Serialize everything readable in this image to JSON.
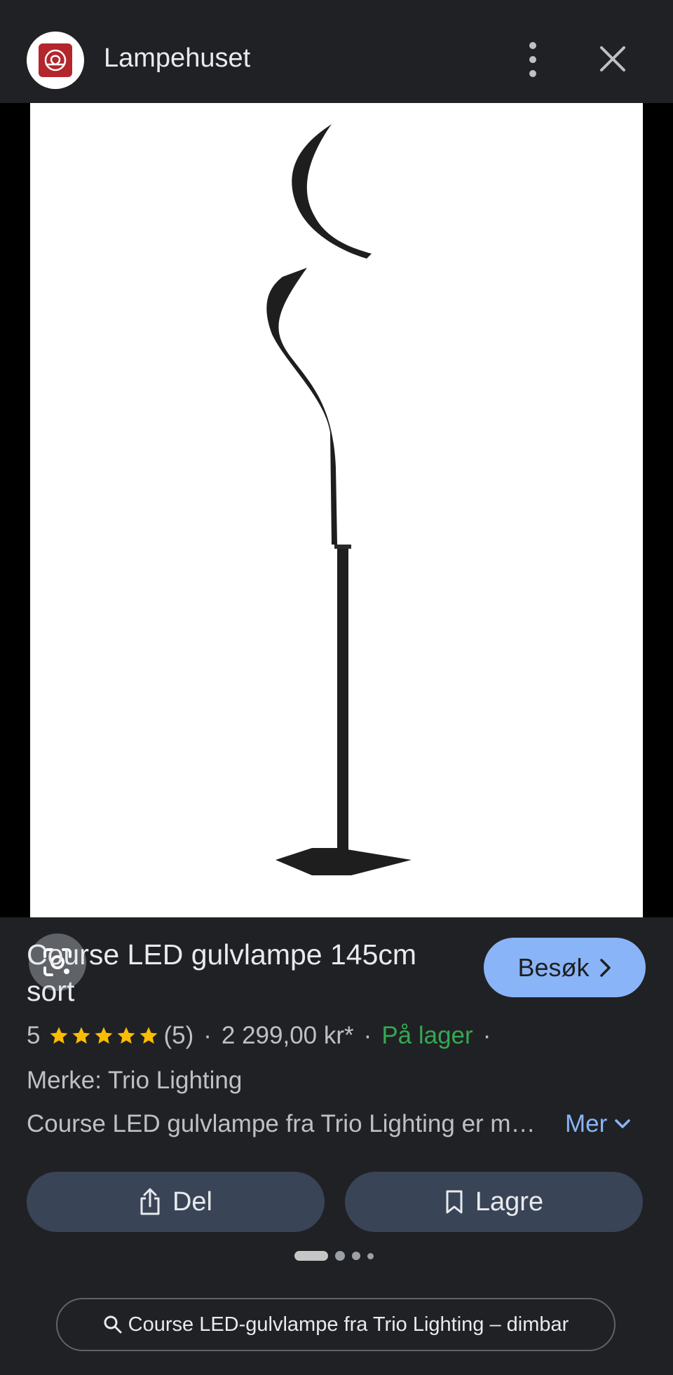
{
  "header": {
    "site_name": "Lampehuset",
    "logo_icon": "lampehuset-logo",
    "more_icon": "more-vert-icon",
    "close_icon": "close-icon"
  },
  "image": {
    "subject": "black spiral LED floor lamp",
    "lens_icon": "google-lens-icon"
  },
  "product": {
    "title": "Course LED gulvlampe 145cm sort",
    "visit_label": "Besøk",
    "rating_value": "5",
    "rating_stars": 5,
    "review_count": "(5)",
    "price": "2 299,00 kr*",
    "stock": "På lager",
    "separator": "·",
    "brand": "Merke: Trio Lighting",
    "description": "Course LED gulvlampe fra Trio Lighting er moderne",
    "more_label": "Mer"
  },
  "actions": {
    "share_label": "Del",
    "save_label": "Lagre"
  },
  "pager": {
    "total": 4,
    "active": 1
  },
  "search": {
    "query": "Course LED-gulvlampe fra Trio Lighting – dimbar"
  },
  "colors": {
    "background": "#202124",
    "accent_button": "#8ab4f8",
    "action_button": "#394457",
    "stock_green": "#34a853",
    "star_yellow": "#fbbc04",
    "logo_red": "#b3262b"
  }
}
